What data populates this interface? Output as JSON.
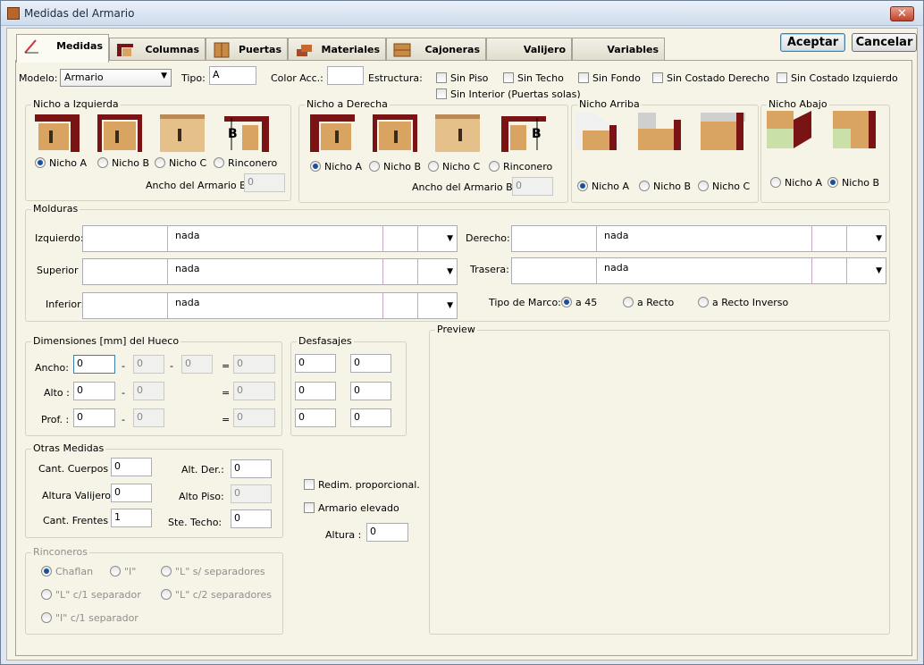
{
  "window": {
    "title": "Medidas del Armario",
    "close": "✕"
  },
  "tabs": [
    {
      "label": "Medidas"
    },
    {
      "label": "Columnas"
    },
    {
      "label": "Puertas"
    },
    {
      "label": "Materiales"
    },
    {
      "label": "Cajoneras"
    },
    {
      "label": "Valijero"
    },
    {
      "label": "Variables"
    }
  ],
  "buttons": {
    "accept": "Aceptar",
    "cancel": "Cancelar"
  },
  "top": {
    "modelo_label": "Modelo:",
    "modelo_value": "Armario",
    "tipo_label": "Tipo:",
    "tipo_value": "A",
    "color_label": "Color Acc.:",
    "color_value": "",
    "estructura_label": "Estructura:",
    "checks": [
      "Sin Piso",
      "Sin Techo",
      "Sin Fondo",
      "Sin Costado Derecho",
      "Sin Costado Izquierdo",
      "Sin Interior (Puertas solas)"
    ]
  },
  "nicho_izq": {
    "title": "Nicho a Izquierda",
    "options": [
      "Nicho A",
      "Nicho B",
      "Nicho C",
      "Rinconero"
    ],
    "selected": 0,
    "ancho_label": "Ancho del Armario B :",
    "ancho_value": "0"
  },
  "nicho_der": {
    "title": "Nicho a Derecha",
    "options": [
      "Nicho A",
      "Nicho B",
      "Nicho C",
      "Rinconero"
    ],
    "selected": 0,
    "ancho_label": "Ancho del Armario B :",
    "ancho_value": "0"
  },
  "nicho_arr": {
    "title": "Nicho Arriba",
    "options": [
      "Nicho A",
      "Nicho B",
      "Nicho C"
    ],
    "selected": 0
  },
  "nicho_aba": {
    "title": "Nicho Abajo",
    "options": [
      "Nicho A",
      "Nicho B"
    ],
    "selected": 1
  },
  "molduras": {
    "title": "Molduras",
    "izquierdo_label": "Izquierdo:",
    "izquierdo_value": "nada",
    "superior_label": "Superior :",
    "superior_value": "nada",
    "inferior_label": "Inferior:",
    "inferior_value": "nada",
    "derecho_label": "Derecho:",
    "derecho_value": "nada",
    "trasera_label": "Trasera:",
    "trasera_value": "nada",
    "marco_label": "Tipo de Marco:",
    "marco_options": [
      "a 45",
      "a Recto",
      "a Recto Inverso"
    ],
    "marco_selected": 0
  },
  "dimensiones": {
    "title": "Dimensiones [mm] del Hueco",
    "ancho_label": "Ancho:",
    "alto_label": "Alto :",
    "prof_label": "Prof. :",
    "ancho": [
      "0",
      "0",
      "0",
      "0"
    ],
    "alto": [
      "0",
      "0",
      "0"
    ],
    "prof": [
      "0",
      "0",
      "0"
    ],
    "minus": "-",
    "equals": "="
  },
  "desfasajes": {
    "title": "Desfasajes",
    "values": [
      "0",
      "0",
      "0",
      "0",
      "0",
      "0"
    ]
  },
  "preview": {
    "title": "Preview"
  },
  "otras": {
    "title": "Otras Medidas",
    "cant_cuerpos_label": "Cant. Cuerpos :",
    "cant_cuerpos": "0",
    "altura_valijero_label": "Altura Valijero :",
    "altura_valijero": "0",
    "cant_frentes_label": "Cant. Frentes :",
    "cant_frentes": "1",
    "alt_der_label": "Alt. Der.:",
    "alt_der": "0",
    "alto_piso_label": "Alto Piso:",
    "alto_piso": "0",
    "ste_techo_label": "Ste. Techo:",
    "ste_techo": "0"
  },
  "extras": {
    "redim_label": "Redim. proporcional.",
    "elevado_label": "Armario elevado",
    "altura_label": "Altura :",
    "altura_value": "0"
  },
  "rinconeros": {
    "title": "Rinconeros",
    "options": [
      "Chaflan",
      "\"I\"",
      "\"L\" s/ separadores",
      "\"L\" c/1 separador",
      "\"L\" c/2 separadores",
      "\"I\" c/1 separador"
    ],
    "selected": 0
  },
  "colors": {
    "wood": "#d9a461",
    "frame": "#7a1414",
    "accent": "#1b4f9c"
  }
}
